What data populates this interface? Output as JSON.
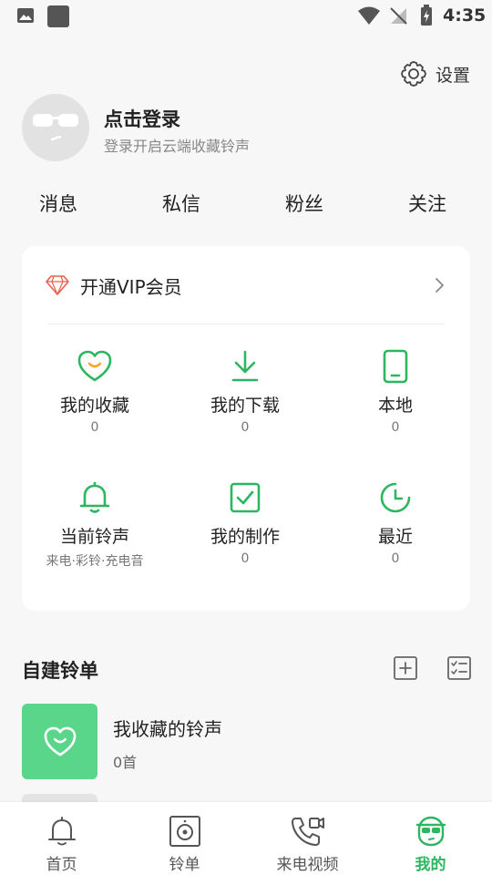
{
  "status_bar": {
    "time": "4:35"
  },
  "header": {
    "settings_label": "设置"
  },
  "profile": {
    "title": "点击登录",
    "subtitle": "登录开启云端收藏铃声"
  },
  "stats": [
    {
      "label": "消息"
    },
    {
      "label": "私信"
    },
    {
      "label": "粉丝"
    },
    {
      "label": "关注"
    }
  ],
  "vip": {
    "label": "开通VIP会员"
  },
  "grid": [
    {
      "label": "我的收藏",
      "count": "0",
      "icon": "heart-smile-icon"
    },
    {
      "label": "我的下载",
      "count": "0",
      "icon": "download-icon"
    },
    {
      "label": "本地",
      "count": "0",
      "icon": "phone-icon"
    },
    {
      "label": "当前铃声",
      "count": "来电·彩铃·充电音",
      "icon": "bell-icon"
    },
    {
      "label": "我的制作",
      "count": "0",
      "icon": "checkbox-icon"
    },
    {
      "label": "最近",
      "count": "0",
      "icon": "clock-icon"
    }
  ],
  "playlists": {
    "section_title": "自建铃单",
    "items": [
      {
        "title": "我收藏的铃声",
        "count": "0首"
      }
    ]
  },
  "tabs": [
    {
      "label": "首页",
      "icon": "home-bell-icon"
    },
    {
      "label": "铃单",
      "icon": "speaker-icon"
    },
    {
      "label": "来电视频",
      "icon": "phone-video-icon"
    },
    {
      "label": "我的",
      "icon": "mine-face-icon",
      "active": true
    }
  ],
  "colors": {
    "accent": "#2db660",
    "cover": "#5ad68a",
    "vip": "#e8604c"
  }
}
